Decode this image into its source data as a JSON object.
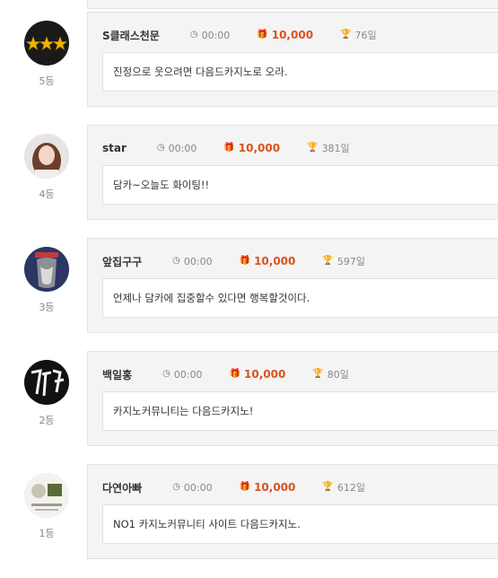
{
  "entries": [
    {
      "name": "S클래스천문",
      "time": "00:00",
      "points": "10,000",
      "days": "76일",
      "rank": "5등",
      "message": "진정으로 웃으려면 다음드카지노로 오라."
    },
    {
      "name": "star",
      "time": "00:00",
      "points": "10,000",
      "days": "381일",
      "rank": "4등",
      "message": "담카~오늘도 화이팅!!"
    },
    {
      "name": "앞집구구",
      "time": "00:00",
      "points": "10,000",
      "days": "597일",
      "rank": "3등",
      "message": "언제나 담카에 집중할수 있다면 행복할것이다."
    },
    {
      "name": "백일홍",
      "time": "00:00",
      "points": "10,000",
      "days": "80일",
      "rank": "2등",
      "message": "카지노커뮤니티는 다음드카지노!"
    },
    {
      "name": "다연아빠",
      "time": "00:00",
      "points": "10,000",
      "days": "612일",
      "rank": "1등",
      "message": "NO1 카지노커뮤니티 사이트 다음드카지노."
    }
  ],
  "icons": {
    "time": "clock-icon",
    "points": "gift-icon",
    "days": "trophy-icon"
  },
  "colors": {
    "points": "#d9531e"
  }
}
